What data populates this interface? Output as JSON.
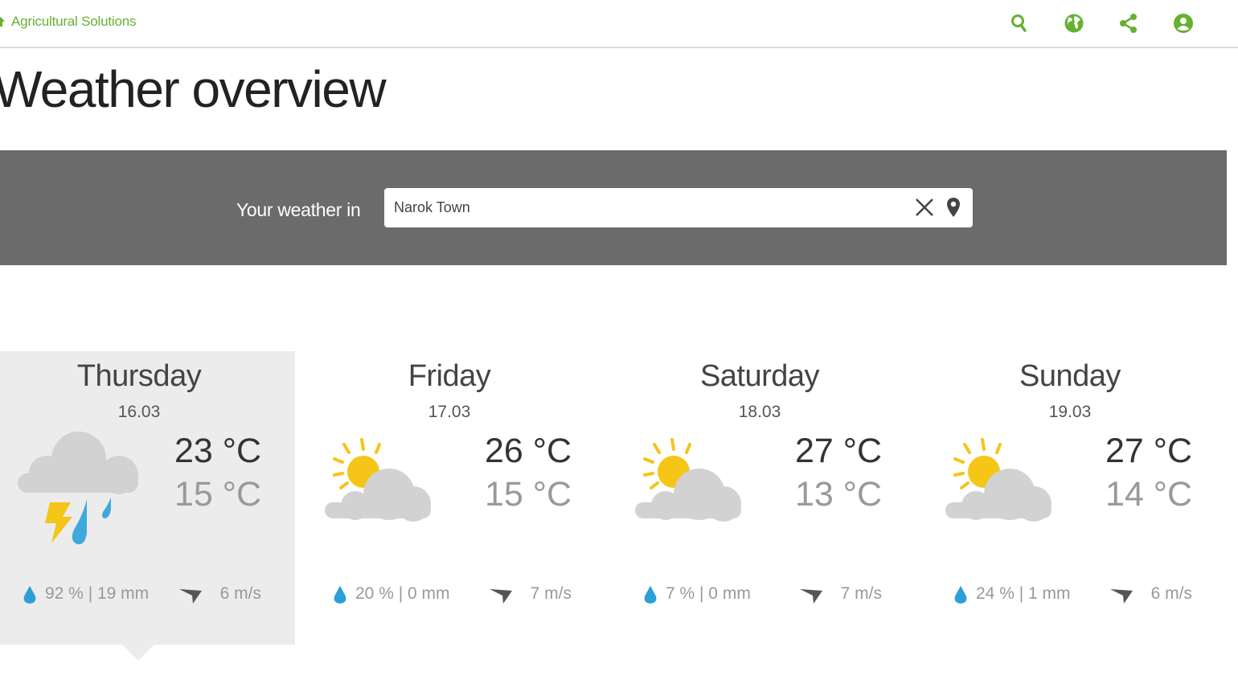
{
  "header": {
    "brand": "Agricultural Solutions"
  },
  "page": {
    "title": "Weather overview"
  },
  "search": {
    "label": "Your weather in",
    "value": "Narok Town"
  },
  "days": [
    {
      "name": "Thursday",
      "date": "16.03",
      "temp_max": "23 °C",
      "temp_min": "15 °C",
      "precip": "92 % | 19 mm",
      "wind": "6 m/s",
      "condition": "thunderstorm-rain-icon",
      "active": true
    },
    {
      "name": "Friday",
      "date": "17.03",
      "temp_max": "26 °C",
      "temp_min": "15 °C",
      "precip": "20 % | 0 mm",
      "wind": "7 m/s",
      "condition": "partly-sunny-icon",
      "active": false
    },
    {
      "name": "Saturday",
      "date": "18.03",
      "temp_max": "27 °C",
      "temp_min": "13 °C",
      "precip": "7 % | 0 mm",
      "wind": "7 m/s",
      "condition": "partly-sunny-icon",
      "active": false
    },
    {
      "name": "Sunday",
      "date": "19.03",
      "temp_max": "27 °C",
      "temp_min": "14 °C",
      "precip": "24 % | 1 mm",
      "wind": "6 m/s",
      "condition": "partly-sunny-icon",
      "active": false
    }
  ],
  "colors": {
    "brand_green": "#66b032",
    "search_band": "#6b6b6b",
    "active_day_bg": "#ececec",
    "sun_yellow": "#f5c518",
    "cloud_gray": "#d2d2d2",
    "rain_blue": "#3fa9dc"
  }
}
